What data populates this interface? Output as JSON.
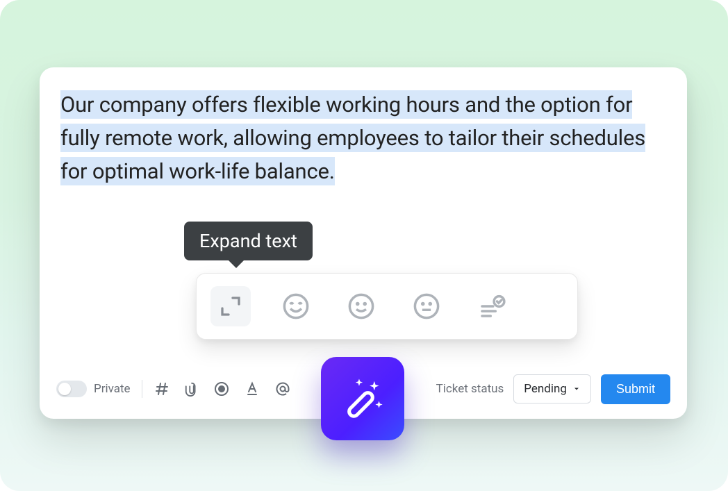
{
  "composer": {
    "text": "Our company offers flexible working hours and the option for fully remote work, allowing employees to tailor their schedules for optimal work-life balance."
  },
  "tooltip": {
    "label": "Expand text"
  },
  "actions": {
    "expand": "expand",
    "happy": "happy",
    "smile": "smile",
    "neutral": "neutral",
    "check": "check"
  },
  "bottom": {
    "private_label": "Private",
    "status_label": "Ticket status",
    "status_value": "Pending",
    "submit_label": "Submit"
  }
}
